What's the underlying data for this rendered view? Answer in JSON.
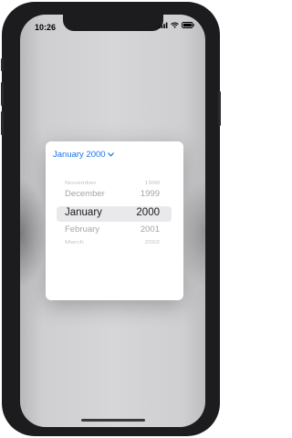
{
  "status_bar": {
    "time": "10:26"
  },
  "date_picker": {
    "header_label": "January 2000",
    "header_icon": "chevron-down-icon",
    "accent_color": "#1a73e8",
    "rows": [
      {
        "month": "November",
        "year": "1998"
      },
      {
        "month": "December",
        "year": "1999"
      },
      {
        "month": "January",
        "year": "2000"
      },
      {
        "month": "February",
        "year": "2001"
      },
      {
        "month": "March",
        "year": "2002"
      }
    ]
  }
}
